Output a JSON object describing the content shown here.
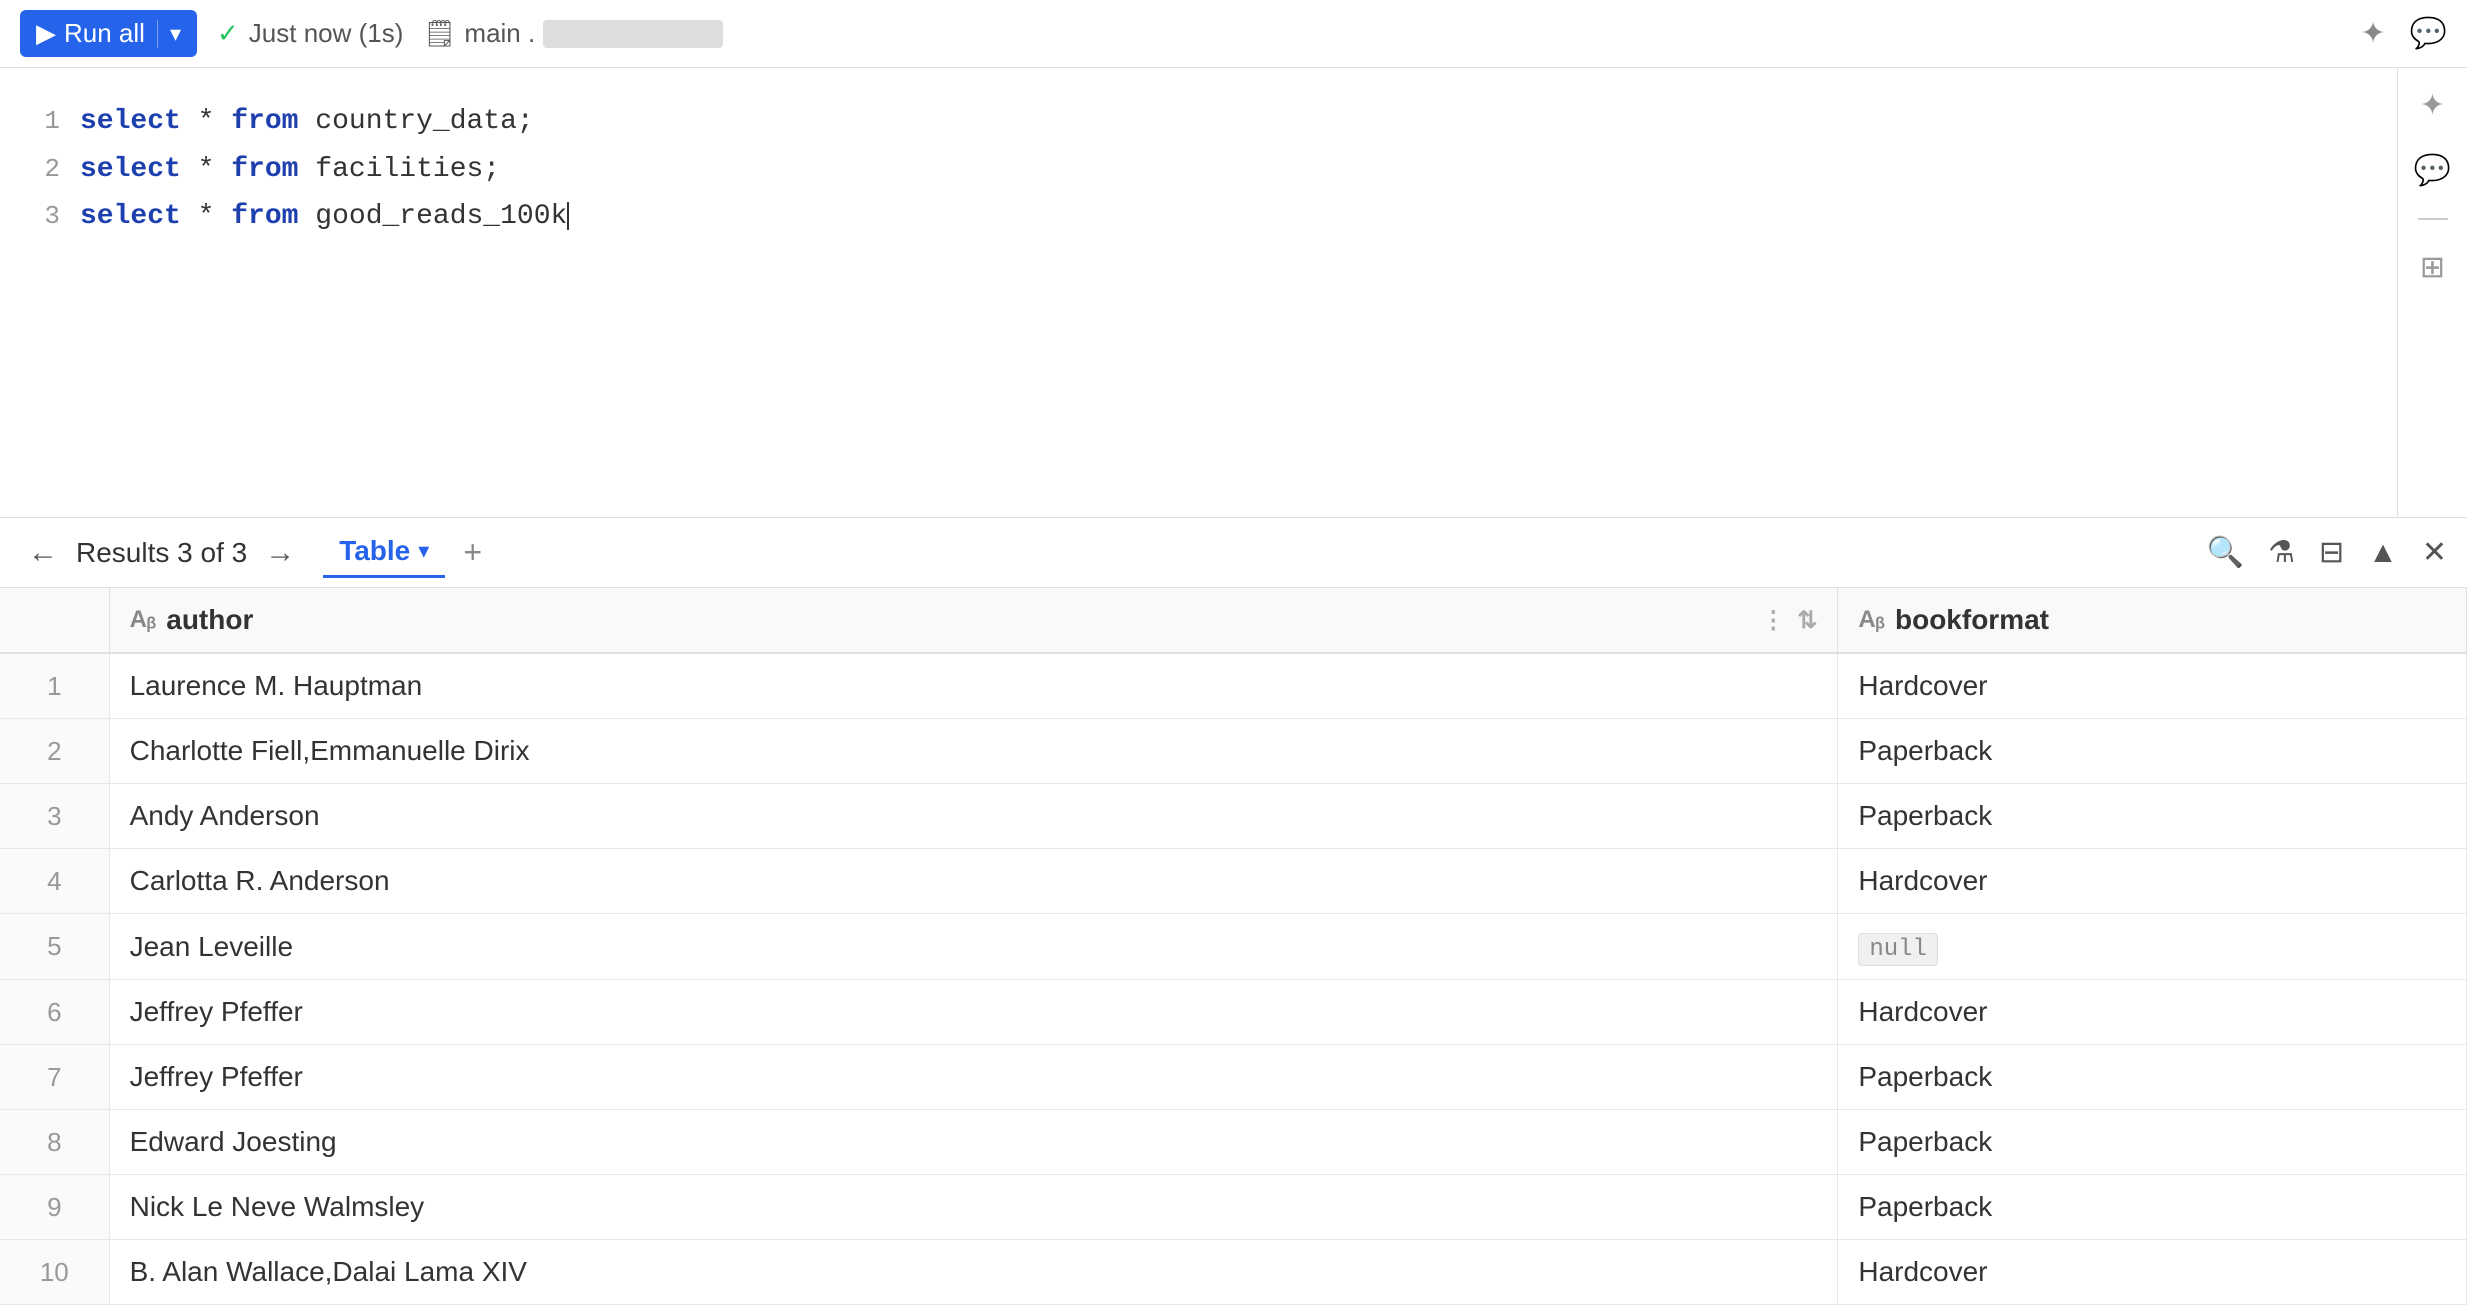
{
  "toolbar": {
    "run_all_label": "Run all",
    "status_text": "Just now (1s)",
    "db_label": "main .",
    "spark_icon": "✦",
    "chat_icon": "💬",
    "settings_icon": "⚙",
    "shortcut_icon": "⌘"
  },
  "editor": {
    "lines": [
      {
        "number": "1",
        "code": "select * from country_data;"
      },
      {
        "number": "2",
        "code": "select * from facilities;"
      },
      {
        "number": "3",
        "code": "select * from good_reads_100k"
      }
    ]
  },
  "results": {
    "label": "Results 3 of 3",
    "tab_label": "Table",
    "add_tab": "+",
    "columns": [
      {
        "icon": "Aᵦ",
        "name": "author"
      },
      {
        "icon": "Aᵦ",
        "name": "bookformat"
      }
    ],
    "rows": [
      {
        "num": "1",
        "author": "Laurence M. Hauptman",
        "bookformat": "Hardcover"
      },
      {
        "num": "2",
        "author": "Charlotte Fiell,Emmanuelle Dirix",
        "bookformat": "Paperback"
      },
      {
        "num": "3",
        "author": "Andy Anderson",
        "bookformat": "Paperback"
      },
      {
        "num": "4",
        "author": "Carlotta R. Anderson",
        "bookformat": "Hardcover"
      },
      {
        "num": "5",
        "author": "Jean Leveille",
        "bookformat": null
      },
      {
        "num": "6",
        "author": "Jeffrey Pfeffer",
        "bookformat": "Hardcover"
      },
      {
        "num": "7",
        "author": "Jeffrey Pfeffer",
        "bookformat": "Paperback"
      },
      {
        "num": "8",
        "author": "Edward Joesting",
        "bookformat": "Paperback"
      },
      {
        "num": "9",
        "author": "Nick Le Neve Walmsley",
        "bookformat": "Paperback"
      },
      {
        "num": "10",
        "author": "B. Alan Wallace,Dalai Lama XIV",
        "bookformat": "Hardcover"
      }
    ],
    "null_label": "null"
  }
}
